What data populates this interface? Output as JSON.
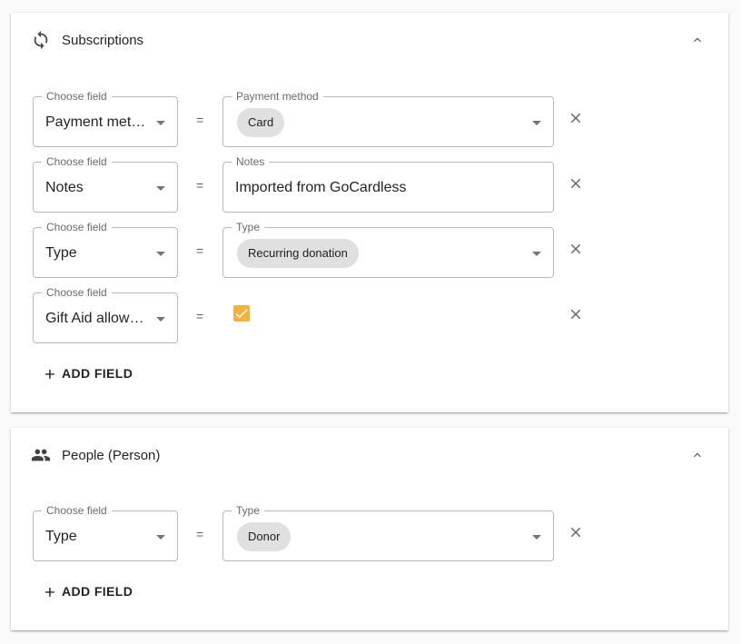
{
  "sections": [
    {
      "title": "Subscriptions",
      "icon": "sync-icon",
      "add_label": "ADD FIELD",
      "rows": [
        {
          "field_legend": "Choose field",
          "field_value": "Payment met…",
          "value_legend": "Payment method",
          "value_type": "chip",
          "chip": "Card"
        },
        {
          "field_legend": "Choose field",
          "field_value": "Notes",
          "value_legend": "Notes",
          "value_type": "text",
          "text": "Imported from GoCardless"
        },
        {
          "field_legend": "Choose field",
          "field_value": "Type",
          "value_legend": "Type",
          "value_type": "chip",
          "chip": "Recurring donation"
        },
        {
          "field_legend": "Choose field",
          "field_value": "Gift Aid allow…",
          "value_type": "checkbox",
          "checked": true
        }
      ]
    },
    {
      "title": "People (Person)",
      "icon": "people-icon",
      "add_label": "ADD FIELD",
      "rows": [
        {
          "field_legend": "Choose field",
          "field_value": "Type",
          "value_legend": "Type",
          "value_type": "chip",
          "chip": "Donor"
        }
      ]
    }
  ],
  "equals_sign": "=",
  "colors": {
    "checkbox_accent": "#f3b23d",
    "chip_bg": "#e0e0e0"
  }
}
